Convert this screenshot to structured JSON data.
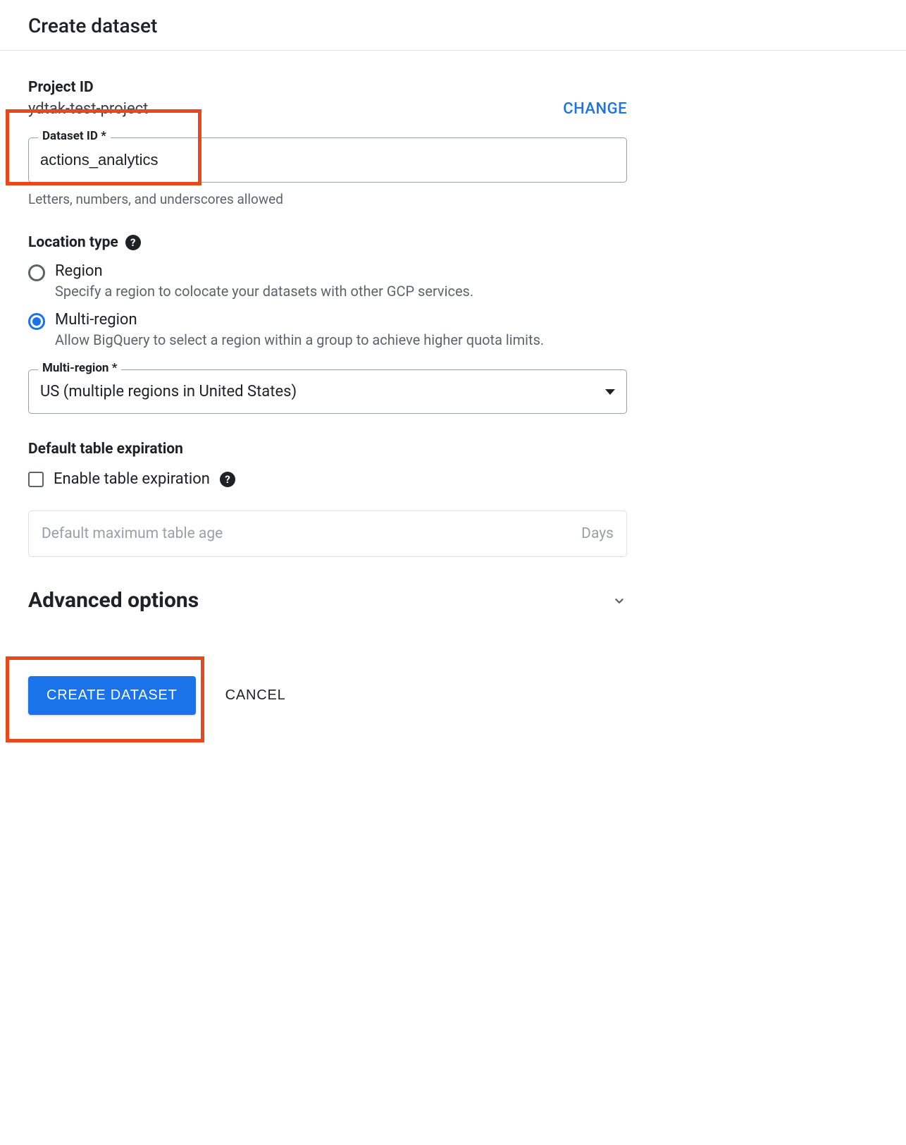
{
  "title": "Create dataset",
  "project": {
    "label": "Project ID",
    "value": "ydtak-test-project",
    "change_label": "CHANGE"
  },
  "dataset_id": {
    "label": "Dataset ID *",
    "value": "actions_analytics",
    "helper": "Letters, numbers, and underscores allowed"
  },
  "location_type": {
    "header": "Location type",
    "options": [
      {
        "label": "Region",
        "desc": "Specify a region to colocate your datasets with other GCP services.",
        "selected": false
      },
      {
        "label": "Multi-region",
        "desc": "Allow BigQuery to select a region within a group to achieve higher quota limits.",
        "selected": true
      }
    ]
  },
  "multi_region": {
    "label": "Multi-region *",
    "value": "US (multiple regions in United States)"
  },
  "table_expiration": {
    "header": "Default table expiration",
    "checkbox_label": "Enable table expiration",
    "age_placeholder": "Default maximum table age",
    "age_unit": "Days"
  },
  "advanced": {
    "label": "Advanced options"
  },
  "footer": {
    "create_label": "CREATE DATASET",
    "cancel_label": "CANCEL"
  }
}
